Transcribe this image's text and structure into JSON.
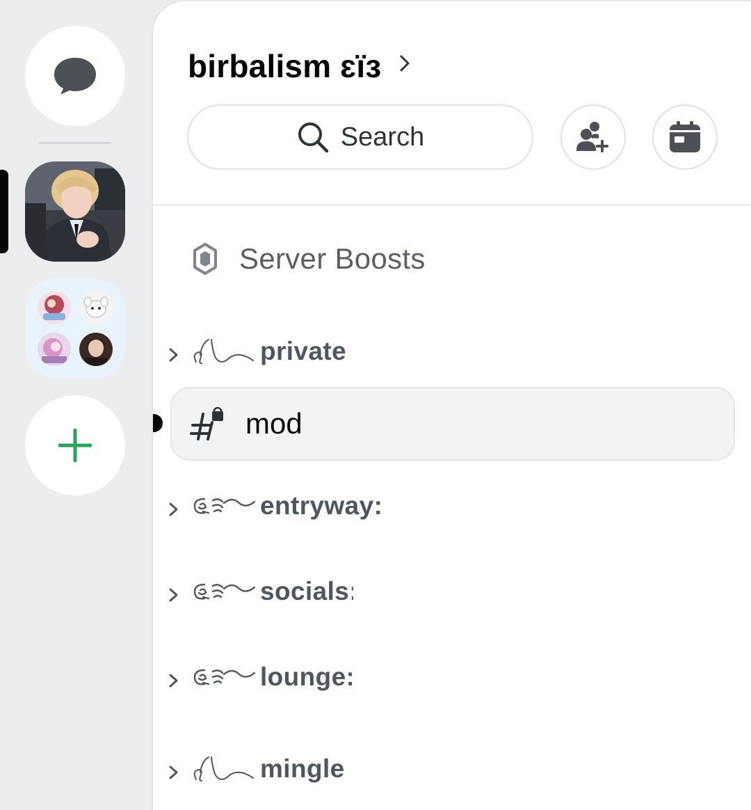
{
  "server": {
    "name": "birbalism ɛïɜ"
  },
  "search": {
    "label": "Search"
  },
  "boosts": {
    "label": "Server Boosts"
  },
  "categories": [
    {
      "label": "private"
    },
    {
      "label": "entryway:"
    },
    {
      "label": "socials:"
    },
    {
      "label": "lounge:"
    },
    {
      "label": "mingle"
    }
  ],
  "selected_channel": {
    "name": "mod"
  },
  "colors": {
    "rail_bg": "#ebedef",
    "panel_bg": "#ffffff",
    "add_server_green": "#23a55a",
    "text_primary": "#060607",
    "text_muted": "#4f5660"
  },
  "icons": {
    "dm": "chat-bubble-icon",
    "add_server": "plus-icon",
    "search": "search-icon",
    "invite": "add-person-icon",
    "events": "calendar-icon",
    "boost": "boost-gem-icon",
    "channel": "hashtag-lock-icon"
  }
}
